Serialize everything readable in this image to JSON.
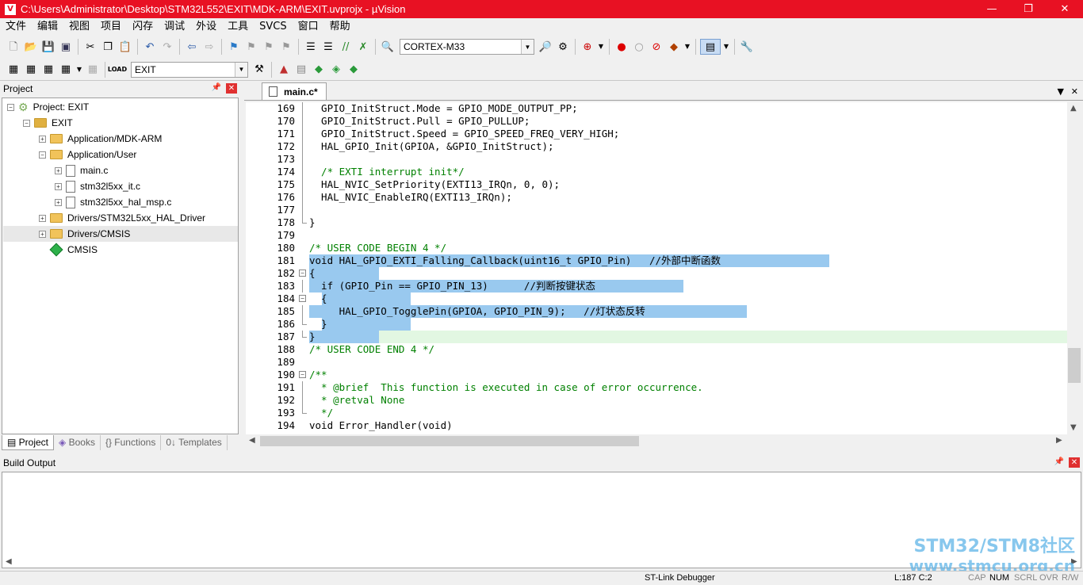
{
  "window": {
    "title": "C:\\Users\\Administrator\\Desktop\\STM32L552\\EXIT\\MDK-ARM\\EXIT.uvprojx - µVision",
    "minimize": "—",
    "maximize": "❐",
    "close": "✕"
  },
  "menu": [
    "文件",
    "编辑",
    "视图",
    "项目",
    "闪存",
    "调试",
    "外设",
    "工具",
    "SVCS",
    "窗口",
    "帮助"
  ],
  "toolbar": {
    "device_combo": "CORTEX-M33",
    "target_combo": "EXIT"
  },
  "project_pane": {
    "title": "Project",
    "tree": [
      {
        "label": "Project: EXIT",
        "level": 0
      },
      {
        "label": "EXIT",
        "level": 1
      },
      {
        "label": "Application/MDK-ARM",
        "level": 2
      },
      {
        "label": "Application/User",
        "level": 2
      },
      {
        "label": "main.c",
        "level": 3
      },
      {
        "label": "stm32l5xx_it.c",
        "level": 3
      },
      {
        "label": "stm32l5xx_hal_msp.c",
        "level": 3
      },
      {
        "label": "Drivers/STM32L5xx_HAL_Driver",
        "level": 2
      },
      {
        "label": "Drivers/CMSIS",
        "level": 2
      },
      {
        "label": "CMSIS",
        "level": 2
      }
    ],
    "tabs": [
      "Project",
      "Books",
      "{} Functions",
      "0↓ Templates"
    ]
  },
  "editor": {
    "tab": "main.c*",
    "lines": [
      {
        "n": "169",
        "t": "  GPIO_InitStruct.Mode = GPIO_MODE_OUTPUT_PP;"
      },
      {
        "n": "170",
        "t": "  GPIO_InitStruct.Pull = GPIO_PULLUP;"
      },
      {
        "n": "171",
        "t": "  GPIO_InitStruct.Speed = GPIO_SPEED_FREQ_VERY_HIGH;"
      },
      {
        "n": "172",
        "t": "  HAL_GPIO_Init(GPIOA, &GPIO_InitStruct);"
      },
      {
        "n": "173",
        "t": ""
      },
      {
        "n": "174",
        "t": "  /* EXTI interrupt init*/"
      },
      {
        "n": "175",
        "t": "  HAL_NVIC_SetPriority(EXTI13_IRQn, 0, 0);"
      },
      {
        "n": "176",
        "t": "  HAL_NVIC_EnableIRQ(EXTI13_IRQn);"
      },
      {
        "n": "177",
        "t": ""
      },
      {
        "n": "178",
        "t": "}"
      },
      {
        "n": "179",
        "t": ""
      },
      {
        "n": "180",
        "t": "/* USER CODE BEGIN 4 */"
      },
      {
        "n": "181",
        "t": "void HAL_GPIO_EXTI_Falling_Callback(uint16_t GPIO_Pin)   //外部中断函数 "
      },
      {
        "n": "182",
        "t": "{"
      },
      {
        "n": "183",
        "t": "  if (GPIO_Pin == GPIO_PIN_13)      //判断按键状态 "
      },
      {
        "n": "184",
        "t": "  {"
      },
      {
        "n": "185",
        "t": "     HAL_GPIO_TogglePin(GPIOA, GPIO_PIN_9);   //灯状态反转 "
      },
      {
        "n": "186",
        "t": "  }"
      },
      {
        "n": "187",
        "t": "}"
      },
      {
        "n": "188",
        "t": "/* USER CODE END 4 */"
      },
      {
        "n": "189",
        "t": ""
      },
      {
        "n": "190",
        "t": "/**"
      },
      {
        "n": "191",
        "t": "  * @brief  This function is executed in case of error occurrence."
      },
      {
        "n": "192",
        "t": "  * @retval None"
      },
      {
        "n": "193",
        "t": "  */"
      },
      {
        "n": "194",
        "t": "void Error_Handler(void)"
      }
    ]
  },
  "build_output": {
    "title": "Build Output"
  },
  "status": {
    "debugger": "ST-Link Debugger",
    "position": "L:187 C:2",
    "caps": "CAP",
    "num": "NUM",
    "scrl": "SCRL",
    "ovr": "OVR",
    "rw": "R/W"
  },
  "watermark": {
    "line1": "STM32/STM8社区",
    "line2": "www.stmcu.org.cn"
  },
  "colors": {
    "titlebar": "#e81123",
    "selection": "#99c9ef",
    "current_line": "#e2f7e2",
    "comment": "#008000",
    "keyword": "#1f1fbf"
  }
}
